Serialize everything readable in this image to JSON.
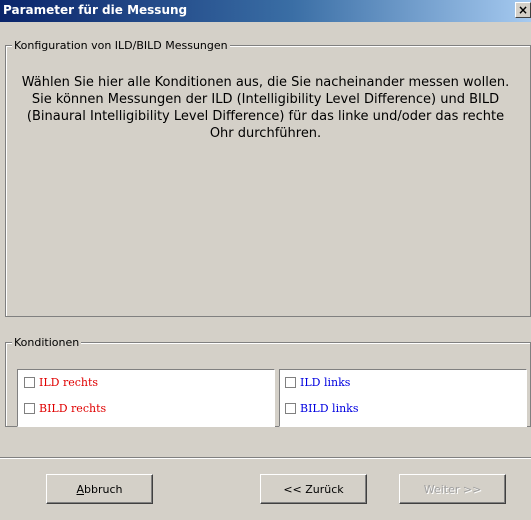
{
  "window": {
    "title": "Parameter für die Messung",
    "close_label": "×"
  },
  "config_group": {
    "legend": "Konfiguration von ILD/BILD Messungen",
    "info_text": "Wählen Sie hier alle Konditionen aus, die Sie nacheinander messen wollen. Sie können Messungen der ILD (Intelligibility Level Difference) und BILD (Binaural Intelligibility Level Difference) für das linke und/oder das rechte Ohr durchführen."
  },
  "conditions_group": {
    "legend": "Konditionen",
    "right_ear": [
      {
        "label": "ILD rechts",
        "checked": false,
        "color": "#e00000"
      },
      {
        "label": "BILD rechts",
        "checked": false,
        "color": "#e00000"
      }
    ],
    "left_ear": [
      {
        "label": "ILD links",
        "checked": false,
        "color": "#0000e0"
      },
      {
        "label": "BILD links",
        "checked": false,
        "color": "#0000e0"
      }
    ]
  },
  "buttons": {
    "cancel_accel": "A",
    "cancel_rest": "bbruch",
    "back": "<< Zurück",
    "next": "Weiter >>"
  }
}
